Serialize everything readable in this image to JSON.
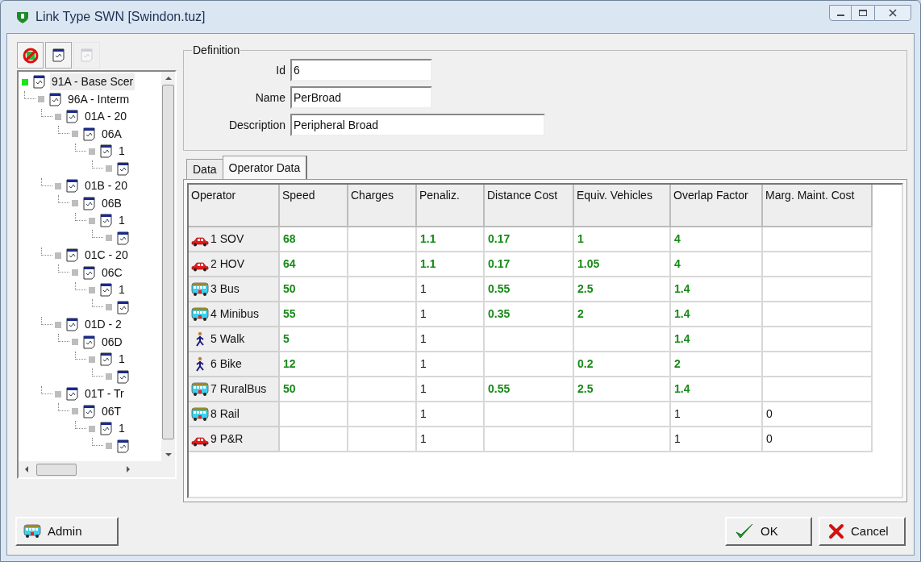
{
  "window": {
    "title": "Link Type  SWN [Swindon.tuz]"
  },
  "toolbar": [
    {
      "kind": "cancel",
      "disabled": false
    },
    {
      "kind": "document",
      "disabled": false
    },
    {
      "kind": "document",
      "disabled": true
    }
  ],
  "tree": [
    {
      "label": "91A  - Base Scer",
      "active": true,
      "selected": true,
      "children": [
        {
          "label": "96A  - Interm",
          "active": false,
          "selected": false,
          "children": [
            {
              "label": "01A  - 20",
              "active": false,
              "selected": false,
              "children": [
                {
                  "label": "06A",
                  "active": false,
                  "selected": false,
                  "children": [
                    {
                      "label": "1",
                      "active": false,
                      "selected": false,
                      "children": [
                        {
                          "active": false,
                          "selected": false
                        }
                      ]
                    }
                  ]
                }
              ]
            },
            {
              "label": "01B  - 20",
              "active": false,
              "selected": false,
              "children": [
                {
                  "label": "06B",
                  "active": false,
                  "selected": false,
                  "children": [
                    {
                      "label": "1",
                      "active": false,
                      "selected": false,
                      "children": [
                        {
                          "active": false,
                          "selected": false
                        }
                      ]
                    }
                  ]
                }
              ]
            },
            {
              "label": "01C  - 20",
              "active": false,
              "selected": false,
              "children": [
                {
                  "label": "06C",
                  "active": false,
                  "selected": false,
                  "children": [
                    {
                      "label": "1",
                      "active": false,
                      "selected": false,
                      "children": [
                        {
                          "active": false,
                          "selected": false
                        }
                      ]
                    }
                  ]
                }
              ]
            },
            {
              "label": "01D  - 2",
              "active": false,
              "selected": false,
              "children": [
                {
                  "label": "06D",
                  "active": false,
                  "selected": false,
                  "children": [
                    {
                      "label": "1",
                      "active": false,
                      "selected": false,
                      "children": [
                        {
                          "active": false,
                          "selected": false
                        }
                      ]
                    }
                  ]
                }
              ]
            },
            {
              "label": "01T  - Tr",
              "active": false,
              "selected": false,
              "children": [
                {
                  "label": "06T",
                  "active": false,
                  "selected": false,
                  "children": [
                    {
                      "label": "1",
                      "active": false,
                      "selected": false,
                      "children": [
                        {
                          "active": false,
                          "selected": false
                        }
                      ]
                    }
                  ]
                }
              ]
            }
          ]
        }
      ]
    }
  ],
  "definition": {
    "title": "Definition",
    "fields": [
      {
        "label": "Id",
        "value": "6",
        "wide": false
      },
      {
        "label": "Name",
        "value": "PerBroad",
        "wide": false
      },
      {
        "label": "Description",
        "value": "Peripheral Broad",
        "wide": true
      }
    ]
  },
  "tabs": [
    {
      "label": "Data",
      "selected": false
    },
    {
      "label": "Operator Data",
      "selected": true
    }
  ],
  "table": {
    "columns": [
      "Operator",
      "Speed",
      "Charges",
      "Penaliz.",
      "Distance Cost",
      "Equiv. Vehicles",
      "Overlap Factor",
      "Marg. Maint. Cost"
    ],
    "rows": [
      {
        "kind": "car",
        "cells": [
          "1 SOV",
          {
            "text": "68",
            "green": true
          },
          "",
          {
            "text": "1.1",
            "green": true
          },
          {
            "text": "0.17",
            "green": true
          },
          {
            "text": "1",
            "green": true
          },
          {
            "text": "4",
            "green": true
          },
          ""
        ]
      },
      {
        "kind": "car",
        "cells": [
          "2 HOV",
          {
            "text": "64",
            "green": true
          },
          "",
          {
            "text": "1.1",
            "green": true
          },
          {
            "text": "0.17",
            "green": true
          },
          {
            "text": "1.05",
            "green": true
          },
          {
            "text": "4",
            "green": true
          },
          ""
        ]
      },
      {
        "kind": "bus",
        "cells": [
          "3 Bus",
          {
            "text": "50",
            "green": true
          },
          "",
          {
            "text": "1",
            "green": false
          },
          {
            "text": "0.55",
            "green": true
          },
          {
            "text": "2.5",
            "green": true
          },
          {
            "text": "1.4",
            "green": true
          },
          ""
        ]
      },
      {
        "kind": "bus",
        "cells": [
          "4 Minibus",
          {
            "text": "55",
            "green": true
          },
          "",
          {
            "text": "1",
            "green": false
          },
          {
            "text": "0.35",
            "green": true
          },
          {
            "text": "2",
            "green": true
          },
          {
            "text": "1.4",
            "green": true
          },
          ""
        ]
      },
      {
        "kind": "walker",
        "cells": [
          "5 Walk",
          {
            "text": "5",
            "green": true
          },
          "",
          {
            "text": "1",
            "green": false
          },
          "",
          "",
          {
            "text": "1.4",
            "green": true
          },
          ""
        ]
      },
      {
        "kind": "walker",
        "cells": [
          "6 Bike",
          {
            "text": "12",
            "green": true
          },
          "",
          {
            "text": "1",
            "green": false
          },
          "",
          {
            "text": "0.2",
            "green": true
          },
          {
            "text": "2",
            "green": true
          },
          ""
        ]
      },
      {
        "kind": "bus",
        "cells": [
          "7 RuralBus",
          {
            "text": "50",
            "green": true
          },
          "",
          {
            "text": "1",
            "green": false
          },
          {
            "text": "0.55",
            "green": true
          },
          {
            "text": "2.5",
            "green": true
          },
          {
            "text": "1.4",
            "green": true
          },
          ""
        ]
      },
      {
        "kind": "bus",
        "cells": [
          "8 Rail",
          "",
          "",
          {
            "text": "1",
            "green": false
          },
          "",
          "",
          {
            "text": "1",
            "green": false
          },
          {
            "text": "0",
            "green": false
          }
        ]
      },
      {
        "kind": "car",
        "cells": [
          "9 P&R",
          "",
          "",
          {
            "text": "1",
            "green": false
          },
          "",
          "",
          {
            "text": "1",
            "green": false
          },
          {
            "text": "0",
            "green": false
          }
        ]
      }
    ]
  },
  "buttons": [
    {
      "kind": "admin",
      "label": "Admin"
    },
    {
      "kind": "ok",
      "label": "OK"
    },
    {
      "kind": "cancel",
      "label": "Cancel"
    }
  ]
}
